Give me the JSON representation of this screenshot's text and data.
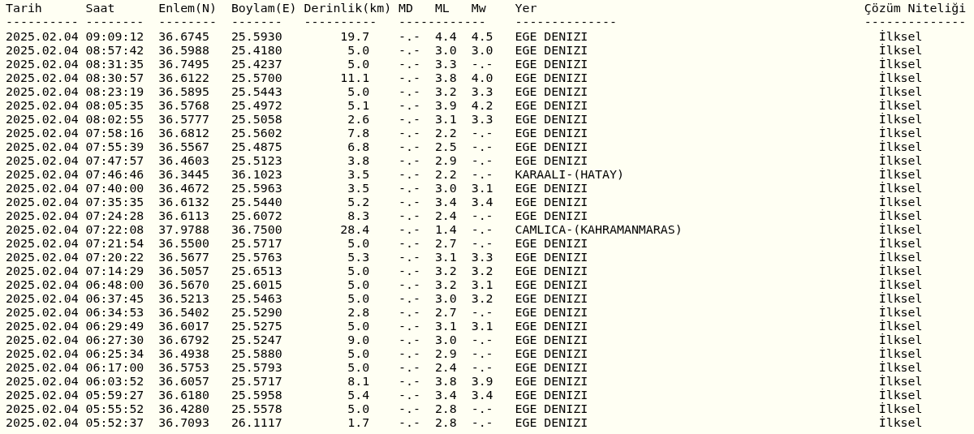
{
  "columns": [
    "Tarih",
    "Saat",
    "Enlem(N)",
    "Boylam(E)",
    "Derinlik(km)",
    "MD",
    "ML",
    "Mw",
    "Yer",
    "Çözüm Niteliği"
  ],
  "underlines": [
    "----------",
    "--------",
    "--------",
    "-------",
    "----------",
    "------------",
    "--------------",
    "--------------"
  ],
  "rows": [
    {
      "date": "2025.02.04",
      "time": "09:09:12",
      "lat": "36.6745",
      "lon": "25.5930",
      "depth": "19.7",
      "md": "-.-",
      "ml": "4.4",
      "mw": "4.5",
      "place": "EGE DENIZI",
      "quality": "İlksel"
    },
    {
      "date": "2025.02.04",
      "time": "08:57:42",
      "lat": "36.5988",
      "lon": "25.4180",
      "depth": "5.0",
      "md": "-.-",
      "ml": "3.0",
      "mw": "3.0",
      "place": "EGE DENIZI",
      "quality": "İlksel"
    },
    {
      "date": "2025.02.04",
      "time": "08:31:35",
      "lat": "36.7495",
      "lon": "25.4237",
      "depth": "5.0",
      "md": "-.-",
      "ml": "3.3",
      "mw": "-.-",
      "place": "EGE DENIZI",
      "quality": "İlksel"
    },
    {
      "date": "2025.02.04",
      "time": "08:30:57",
      "lat": "36.6122",
      "lon": "25.5700",
      "depth": "11.1",
      "md": "-.-",
      "ml": "3.8",
      "mw": "4.0",
      "place": "EGE DENIZI",
      "quality": "İlksel"
    },
    {
      "date": "2025.02.04",
      "time": "08:23:19",
      "lat": "36.5895",
      "lon": "25.5443",
      "depth": "5.0",
      "md": "-.-",
      "ml": "3.2",
      "mw": "3.3",
      "place": "EGE DENIZI",
      "quality": "İlksel"
    },
    {
      "date": "2025.02.04",
      "time": "08:05:35",
      "lat": "36.5768",
      "lon": "25.4972",
      "depth": "5.1",
      "md": "-.-",
      "ml": "3.9",
      "mw": "4.2",
      "place": "EGE DENIZI",
      "quality": "İlksel"
    },
    {
      "date": "2025.02.04",
      "time": "08:02:55",
      "lat": "36.5777",
      "lon": "25.5058",
      "depth": "2.6",
      "md": "-.-",
      "ml": "3.1",
      "mw": "3.3",
      "place": "EGE DENIZI",
      "quality": "İlksel"
    },
    {
      "date": "2025.02.04",
      "time": "07:58:16",
      "lat": "36.6812",
      "lon": "25.5602",
      "depth": "7.8",
      "md": "-.-",
      "ml": "2.2",
      "mw": "-.-",
      "place": "EGE DENIZI",
      "quality": "İlksel"
    },
    {
      "date": "2025.02.04",
      "time": "07:55:39",
      "lat": "36.5567",
      "lon": "25.4875",
      "depth": "6.8",
      "md": "-.-",
      "ml": "2.5",
      "mw": "-.-",
      "place": "EGE DENIZI",
      "quality": "İlksel"
    },
    {
      "date": "2025.02.04",
      "time": "07:47:57",
      "lat": "36.4603",
      "lon": "25.5123",
      "depth": "3.8",
      "md": "-.-",
      "ml": "2.9",
      "mw": "-.-",
      "place": "EGE DENIZI",
      "quality": "İlksel"
    },
    {
      "date": "2025.02.04",
      "time": "07:46:46",
      "lat": "36.3445",
      "lon": "36.1023",
      "depth": "3.5",
      "md": "-.-",
      "ml": "2.2",
      "mw": "-.-",
      "place": "KARAALI-(HATAY)",
      "quality": "İlksel"
    },
    {
      "date": "2025.02.04",
      "time": "07:40:00",
      "lat": "36.4672",
      "lon": "25.5963",
      "depth": "3.5",
      "md": "-.-",
      "ml": "3.0",
      "mw": "3.1",
      "place": "EGE DENIZI",
      "quality": "İlksel"
    },
    {
      "date": "2025.02.04",
      "time": "07:35:35",
      "lat": "36.6132",
      "lon": "25.5440",
      "depth": "5.2",
      "md": "-.-",
      "ml": "3.4",
      "mw": "3.4",
      "place": "EGE DENIZI",
      "quality": "İlksel"
    },
    {
      "date": "2025.02.04",
      "time": "07:24:28",
      "lat": "36.6113",
      "lon": "25.6072",
      "depth": "8.3",
      "md": "-.-",
      "ml": "2.4",
      "mw": "-.-",
      "place": "EGE DENIZI",
      "quality": "İlksel"
    },
    {
      "date": "2025.02.04",
      "time": "07:22:08",
      "lat": "37.9788",
      "lon": "36.7500",
      "depth": "28.4",
      "md": "-.-",
      "ml": "1.4",
      "mw": "-.-",
      "place": "CAMLICA-(KAHRAMANMARAS)",
      "quality": "İlksel"
    },
    {
      "date": "2025.02.04",
      "time": "07:21:54",
      "lat": "36.5500",
      "lon": "25.5717",
      "depth": "5.0",
      "md": "-.-",
      "ml": "2.7",
      "mw": "-.-",
      "place": "EGE DENIZI",
      "quality": "İlksel"
    },
    {
      "date": "2025.02.04",
      "time": "07:20:22",
      "lat": "36.5677",
      "lon": "25.5763",
      "depth": "5.3",
      "md": "-.-",
      "ml": "3.1",
      "mw": "3.3",
      "place": "EGE DENIZI",
      "quality": "İlksel"
    },
    {
      "date": "2025.02.04",
      "time": "07:14:29",
      "lat": "36.5057",
      "lon": "25.6513",
      "depth": "5.0",
      "md": "-.-",
      "ml": "3.2",
      "mw": "3.2",
      "place": "EGE DENIZI",
      "quality": "İlksel"
    },
    {
      "date": "2025.02.04",
      "time": "06:48:00",
      "lat": "36.5670",
      "lon": "25.6015",
      "depth": "5.0",
      "md": "-.-",
      "ml": "3.2",
      "mw": "3.1",
      "place": "EGE DENIZI",
      "quality": "İlksel"
    },
    {
      "date": "2025.02.04",
      "time": "06:37:45",
      "lat": "36.5213",
      "lon": "25.5463",
      "depth": "5.0",
      "md": "-.-",
      "ml": "3.0",
      "mw": "3.2",
      "place": "EGE DENIZI",
      "quality": "İlksel"
    },
    {
      "date": "2025.02.04",
      "time": "06:34:53",
      "lat": "36.5402",
      "lon": "25.5290",
      "depth": "2.8",
      "md": "-.-",
      "ml": "2.7",
      "mw": "-.-",
      "place": "EGE DENIZI",
      "quality": "İlksel"
    },
    {
      "date": "2025.02.04",
      "time": "06:29:49",
      "lat": "36.6017",
      "lon": "25.5275",
      "depth": "5.0",
      "md": "-.-",
      "ml": "3.1",
      "mw": "3.1",
      "place": "EGE DENIZI",
      "quality": "İlksel"
    },
    {
      "date": "2025.02.04",
      "time": "06:27:30",
      "lat": "36.6792",
      "lon": "25.5247",
      "depth": "9.0",
      "md": "-.-",
      "ml": "3.0",
      "mw": "-.-",
      "place": "EGE DENIZI",
      "quality": "İlksel"
    },
    {
      "date": "2025.02.04",
      "time": "06:25:34",
      "lat": "36.4938",
      "lon": "25.5880",
      "depth": "5.0",
      "md": "-.-",
      "ml": "2.9",
      "mw": "-.-",
      "place": "EGE DENIZI",
      "quality": "İlksel"
    },
    {
      "date": "2025.02.04",
      "time": "06:17:00",
      "lat": "36.5753",
      "lon": "25.5793",
      "depth": "5.0",
      "md": "-.-",
      "ml": "2.4",
      "mw": "-.-",
      "place": "EGE DENIZI",
      "quality": "İlksel"
    },
    {
      "date": "2025.02.04",
      "time": "06:03:52",
      "lat": "36.6057",
      "lon": "25.5717",
      "depth": "8.1",
      "md": "-.-",
      "ml": "3.8",
      "mw": "3.9",
      "place": "EGE DENIZI",
      "quality": "İlksel"
    },
    {
      "date": "2025.02.04",
      "time": "05:59:27",
      "lat": "36.6180",
      "lon": "25.5958",
      "depth": "5.4",
      "md": "-.-",
      "ml": "3.4",
      "mw": "3.4",
      "place": "EGE DENIZI",
      "quality": "İlksel"
    },
    {
      "date": "2025.02.04",
      "time": "05:55:52",
      "lat": "36.4280",
      "lon": "25.5578",
      "depth": "5.0",
      "md": "-.-",
      "ml": "2.8",
      "mw": "-.-",
      "place": "EGE DENIZI",
      "quality": "İlksel"
    },
    {
      "date": "2025.02.04",
      "time": "05:52:37",
      "lat": "36.7093",
      "lon": "26.1117",
      "depth": "1.7",
      "md": "-.-",
      "ml": "2.8",
      "mw": "-.-",
      "place": "EGE DENIZI",
      "quality": "İlksel"
    }
  ]
}
